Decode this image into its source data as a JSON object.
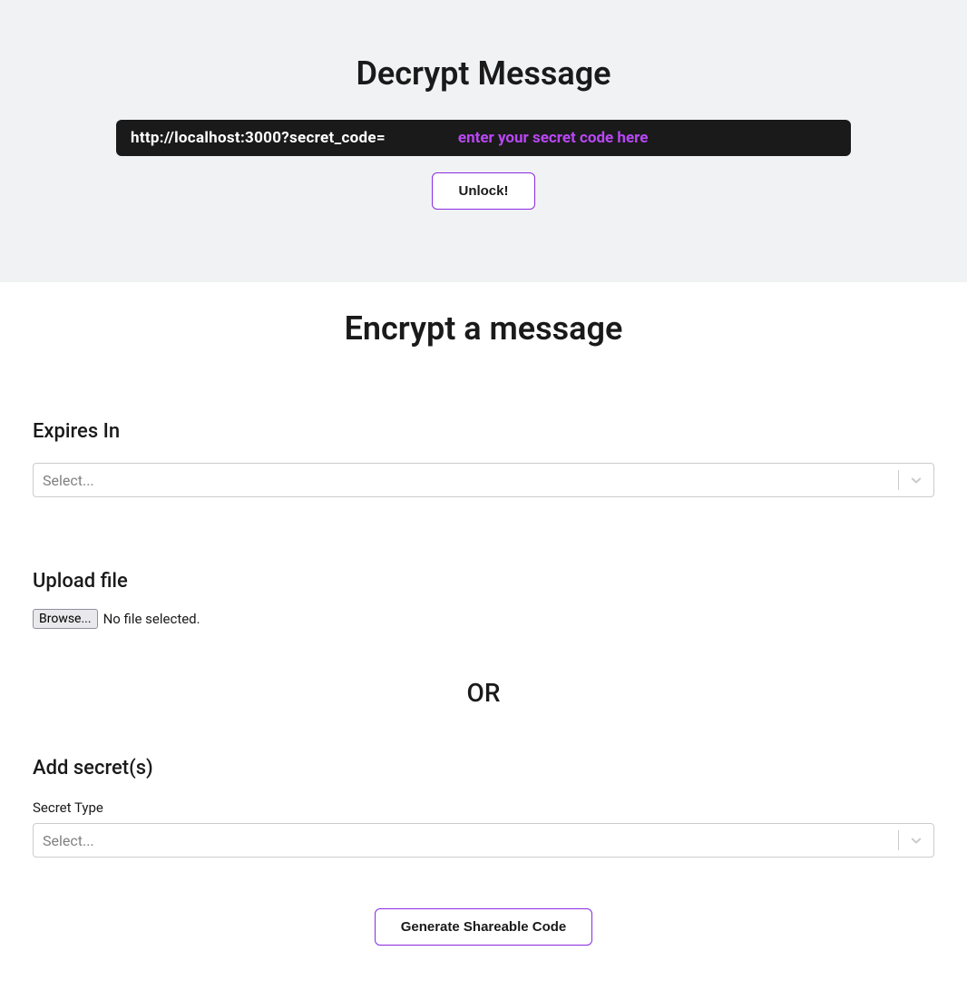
{
  "decrypt": {
    "title": "Decrypt Message",
    "url_prefix": "http://localhost:3000?secret_code=",
    "input_placeholder": "enter your secret code here",
    "unlock_label": "Unlock!"
  },
  "encrypt": {
    "title": "Encrypt a message",
    "expires_label": "Expires In",
    "expires_placeholder": "Select...",
    "upload_label": "Upload file",
    "browse_label": "Browse...",
    "no_file_text": "No file selected.",
    "or_text": "OR",
    "add_secrets_label": "Add secret(s)",
    "secret_type_label": "Secret Type",
    "secret_type_placeholder": "Select...",
    "generate_label": "Generate Shareable Code"
  }
}
